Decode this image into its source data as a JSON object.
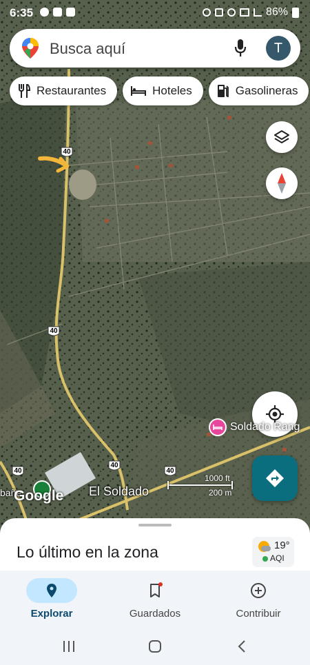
{
  "status_bar": {
    "time": "6:35",
    "battery": "86%"
  },
  "search": {
    "placeholder": "Busca aquí",
    "avatar_letter": "T"
  },
  "chips": [
    {
      "label": "Restaurantes",
      "icon": "fork-knife-icon"
    },
    {
      "label": "Hoteles",
      "icon": "bed-icon"
    },
    {
      "label": "Gasolineras",
      "icon": "gas-pump-icon"
    }
  ],
  "map": {
    "route_shield": "40",
    "place_label": "El Soldado",
    "poi_label": "Soldado Rang",
    "left_label": "bañe",
    "google_logo": "Google",
    "scale_ft": "1000 ft",
    "scale_m": "200 m"
  },
  "sheet": {
    "title": "Lo último en la zona",
    "weather_temp": "19°",
    "weather_aqi": "AQI"
  },
  "nav": [
    {
      "label": "Explorar",
      "icon": "explore-pin-icon",
      "active": true
    },
    {
      "label": "Guardados",
      "icon": "bookmark-icon",
      "active": false
    },
    {
      "label": "Contribuir",
      "icon": "add-circle-icon",
      "active": false
    }
  ],
  "colors": {
    "accent": "#0b6e7e",
    "nav_active_pill": "#c3e7ff",
    "road": "#d9c16a"
  }
}
